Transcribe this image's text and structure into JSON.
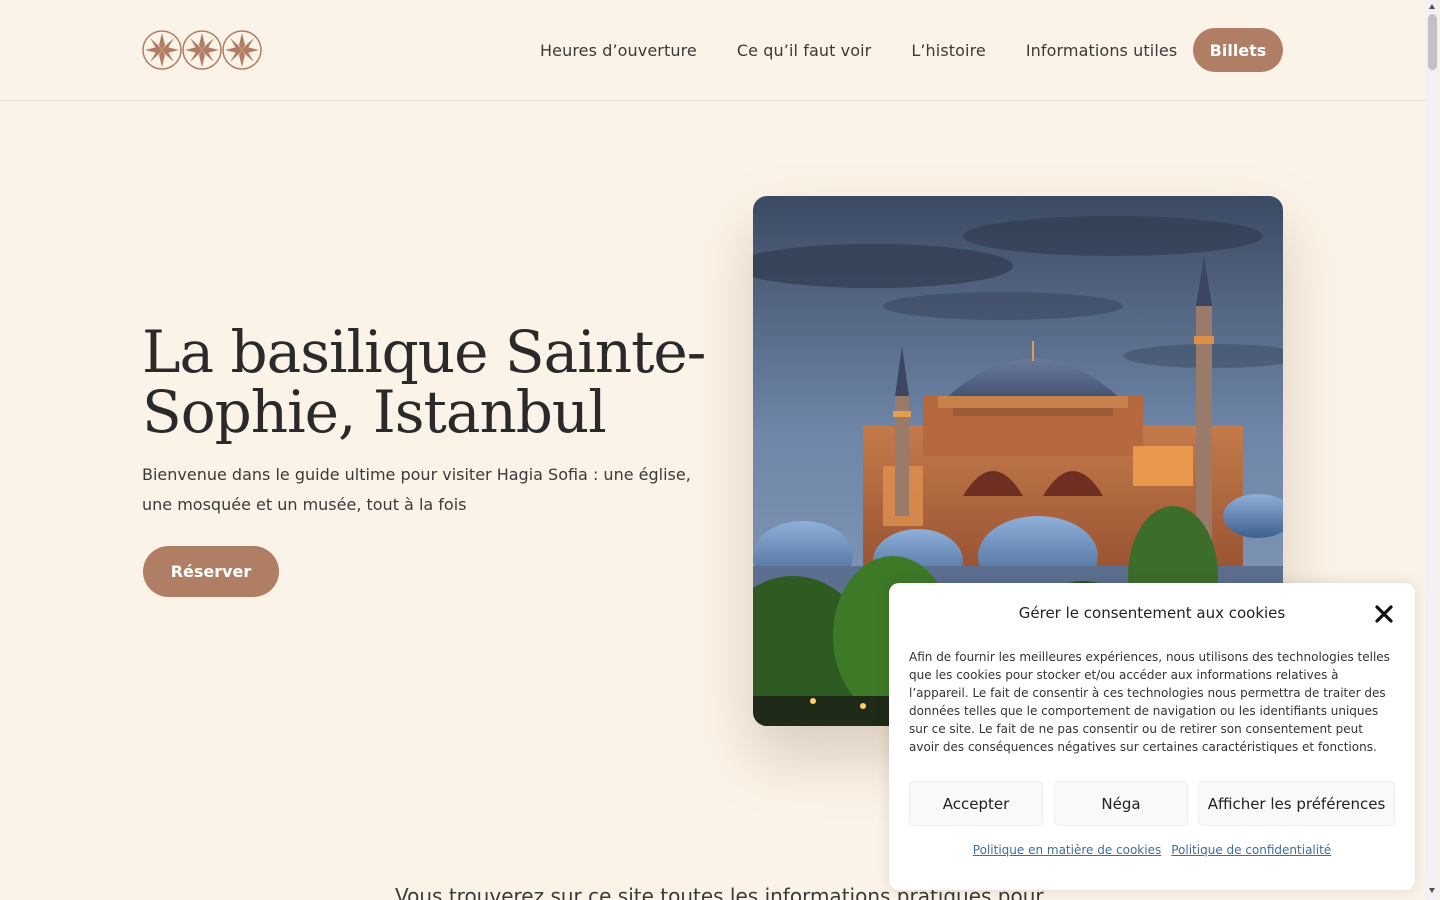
{
  "header": {
    "logo_icon": "ornament-logo-icon",
    "nav": [
      {
        "label": "Heures d’ouverture"
      },
      {
        "label": "Ce qu’il faut voir"
      },
      {
        "label": "L’histoire"
      },
      {
        "label": "Informations utiles"
      }
    ],
    "cta_label": "Billets"
  },
  "hero": {
    "title": "La basilique Sainte-Sophie, Istanbul",
    "subtitle": "Bienvenue dans le guide ultime pour visiter Hagia Sofia : une église, une mosquée et un musée, tout à la fois",
    "button_label": "Réserver",
    "image_icon": "hagia-sophia-photo"
  },
  "below_fold": {
    "text": "Vous trouverez sur ce site toutes les informations pratiques pour"
  },
  "cookie_dialog": {
    "title": "Gérer le consentement aux cookies",
    "close_icon": "close-icon",
    "body": "Afin de fournir les meilleures expériences, nous utilisons des technologies telles que les cookies pour stocker et/ou accéder aux informations relatives à l’appareil. Le fait de consentir à ces technologies nous permettra de traiter des données telles que le comportement de navigation ou les identifiants uniques sur ce site. Le fait de ne pas consentir ou de retirer son consentement peut avoir des conséquences négatives sur certaines caractéristiques et fonctions.",
    "accept_label": "Accepter",
    "deny_label": "Néga",
    "prefs_label": "Afficher les préférences",
    "links": [
      {
        "label": "Politique en matière de cookies"
      },
      {
        "label": "Politique de confidentialité"
      }
    ]
  },
  "colors": {
    "background": "#fcf3e8",
    "accent": "#b07e64",
    "link": "#3f6e96"
  }
}
